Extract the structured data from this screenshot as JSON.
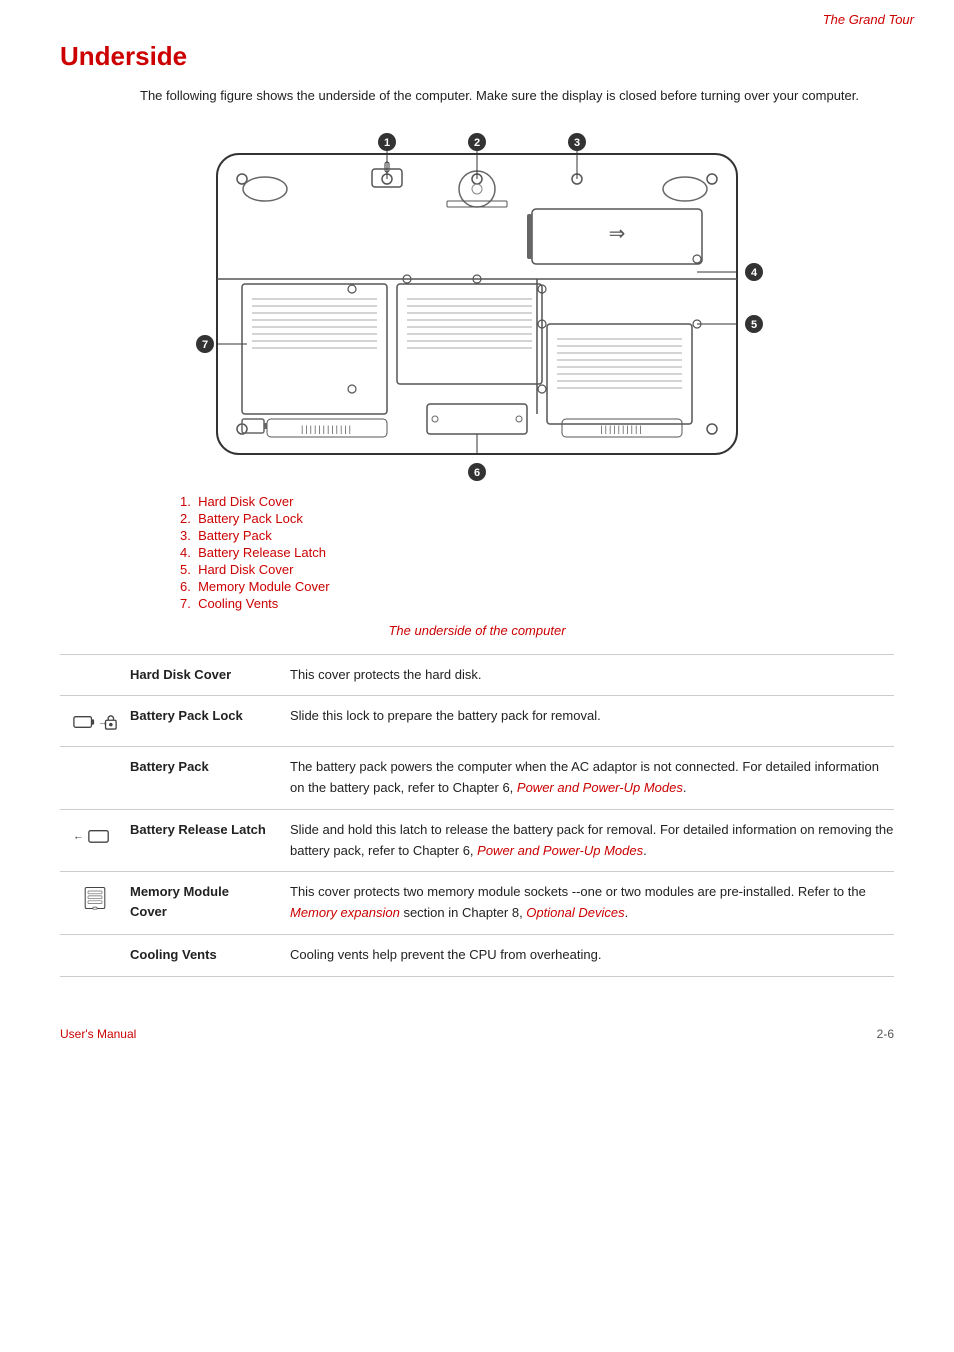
{
  "header": {
    "title": "The Grand Tour"
  },
  "section": {
    "title": "Underside",
    "intro": "The following figure shows the underside of the computer. Make sure the display is closed before turning over your computer.",
    "caption": "The underside of the computer"
  },
  "numbered_list": [
    {
      "num": "1.",
      "label": "Hard Disk Cover"
    },
    {
      "num": "2.",
      "label": "Battery Pack Lock"
    },
    {
      "num": "3.",
      "label": "Battery Pack"
    },
    {
      "num": "4.",
      "label": "Battery Release Latch"
    },
    {
      "num": "5.",
      "label": "Hard Disk Cover"
    },
    {
      "num": "6.",
      "label": "Memory Module Cover"
    },
    {
      "num": "7.",
      "label": "Cooling Vents"
    }
  ],
  "table": [
    {
      "term": "Hard Disk Cover",
      "desc": "This cover protects the hard disk.",
      "icon": "none"
    },
    {
      "term": "Battery Pack Lock",
      "desc": "Slide this lock to prepare the battery pack for removal.",
      "icon": "battery-lock"
    },
    {
      "term": "Battery Pack",
      "desc": "The battery pack powers the computer when the AC adaptor is not connected. For detailed information on the battery pack, refer to Chapter 6, ",
      "link": "Power and Power-Up Modes",
      "desc2": ".",
      "icon": "none"
    },
    {
      "term": "Battery Release Latch",
      "desc": "Slide and hold this latch to release the battery pack for removal. For detailed information on removing the battery pack, refer to Chapter 6, ",
      "link": "Power and Power-Up Modes",
      "desc2": ".",
      "icon": "battery-latch"
    },
    {
      "term": "Memory Module Cover",
      "desc": "This cover protects two memory module sockets --one or two modules are pre-installed. Refer to the ",
      "link": "Memory expansion",
      "desc2": " section in Chapter 8, ",
      "link2": "Optional Devices",
      "desc3": ".",
      "icon": "memory"
    },
    {
      "term": "Cooling Vents",
      "desc": "Cooling vents help prevent the CPU from overheating.",
      "icon": "none"
    }
  ],
  "footer": {
    "left": "User's Manual",
    "right": "2-6"
  }
}
